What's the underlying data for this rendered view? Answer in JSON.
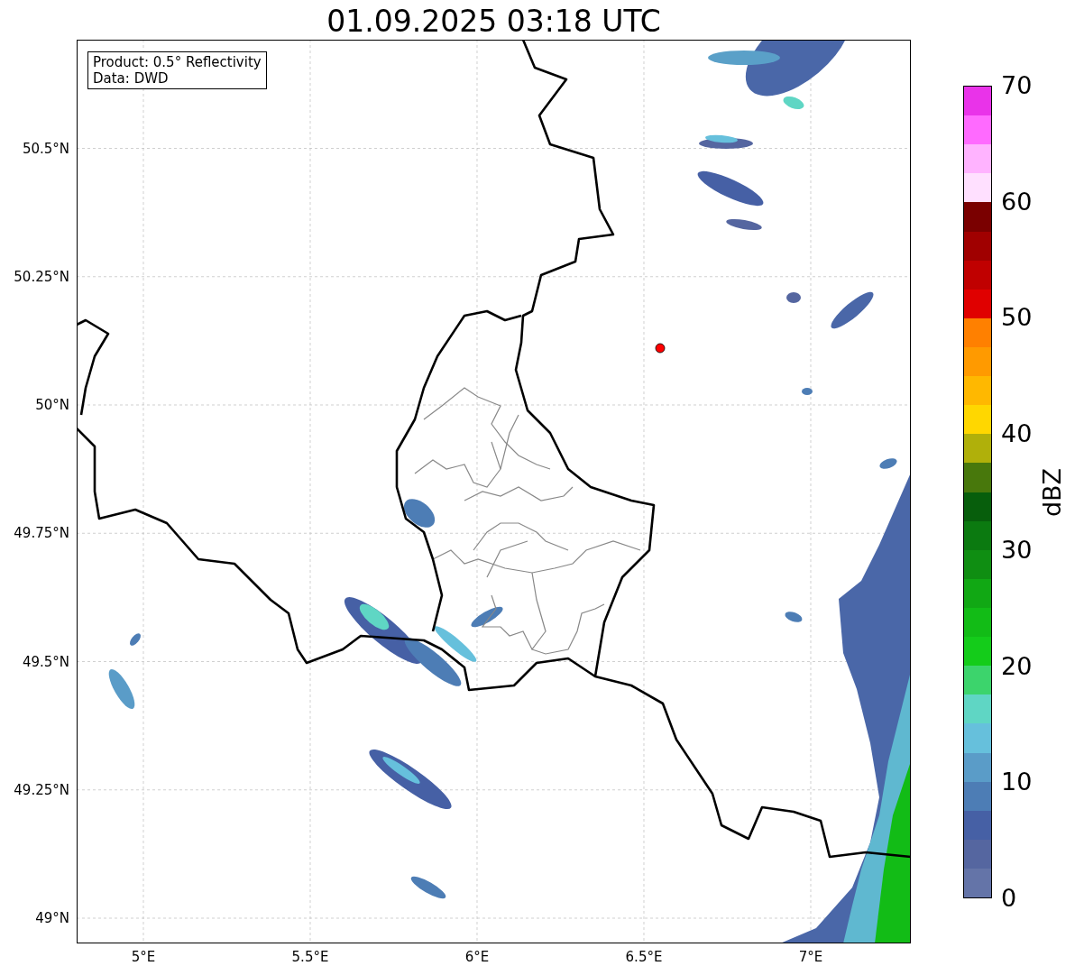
{
  "title": "01.09.2025 03:18 UTC",
  "info_box": [
    "Product: 0.5° Reflectivity",
    "Data: DWD"
  ],
  "map": {
    "xticks": [
      "5°E",
      "5.5°E",
      "6°E",
      "6.5°E",
      "7°E"
    ],
    "yticks": [
      "50.5°N",
      "50.25°N",
      "50°N",
      "49.75°N",
      "49.5°N",
      "49.25°N",
      "49°N"
    ]
  },
  "colorbar": {
    "label": "dBZ",
    "ticks": [
      "70",
      "60",
      "50",
      "40",
      "30",
      "20",
      "10",
      "0"
    ],
    "bins": [
      {
        "color": "#e933e9"
      },
      {
        "color": "#ff6aff"
      },
      {
        "color": "#ffb3ff"
      },
      {
        "color": "#ffe0ff"
      },
      {
        "color": "#7a0000"
      },
      {
        "color": "#a00000"
      },
      {
        "color": "#c00000"
      },
      {
        "color": "#e00000"
      },
      {
        "color": "#ff8000"
      },
      {
        "color": "#ff9a00"
      },
      {
        "color": "#ffb800"
      },
      {
        "color": "#ffd700"
      },
      {
        "color": "#b0b00a"
      },
      {
        "color": "#48780c"
      },
      {
        "color": "#075e0c"
      },
      {
        "color": "#0b7a10"
      },
      {
        "color": "#0f8e12"
      },
      {
        "color": "#11a814"
      },
      {
        "color": "#12bc16"
      },
      {
        "color": "#14cc1a"
      },
      {
        "color": "#3cd46c"
      },
      {
        "color": "#5fd6c4"
      },
      {
        "color": "#66c0dc"
      },
      {
        "color": "#5a9cc8"
      },
      {
        "color": "#4d7db5"
      },
      {
        "color": "#4660a5"
      },
      {
        "color": "#5566a0"
      },
      {
        "color": "#6474a8"
      }
    ]
  }
}
